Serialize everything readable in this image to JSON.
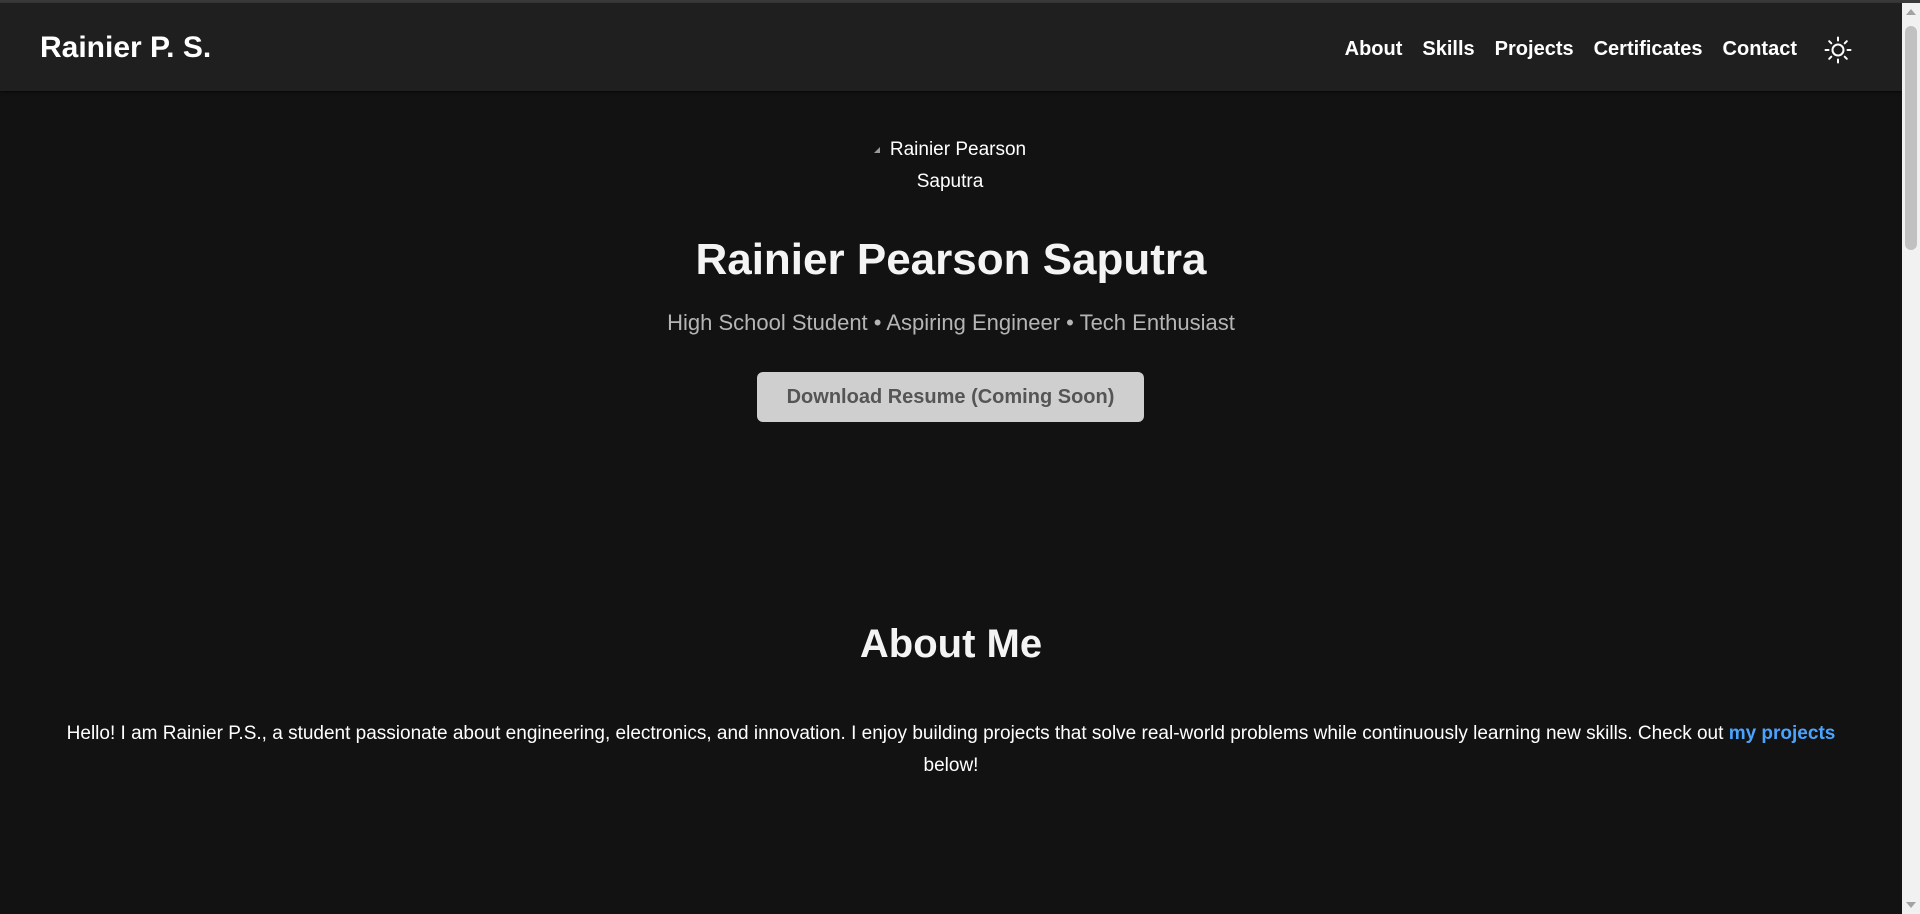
{
  "nav": {
    "brand": "Rainier P. S.",
    "links": [
      "About",
      "Skills",
      "Projects",
      "Certificates",
      "Contact"
    ]
  },
  "hero": {
    "image_alt_line1": "Rainier Pearson",
    "image_alt_line2": "Saputra",
    "name": "Rainier Pearson Saputra",
    "subtitle": "High School Student • Aspiring Engineer • Tech Enthusiast",
    "resume_button": "Download Resume (Coming Soon)"
  },
  "about": {
    "title": "About Me",
    "text_before": "Hello! I am Rainier P.S., a student passionate about engineering, electronics, and innovation. I enjoy building projects that solve real-world problems while continuously learning new skills. Check out ",
    "link_text": "my projects",
    "text_after": " below!"
  },
  "colors": {
    "background": "#121212",
    "navbar": "#1f1f1f",
    "link_accent": "#4aa3ff",
    "button_bg": "#cfcfcf"
  },
  "icons": {
    "theme_toggle": "sun-icon",
    "hero_image": "broken-image-icon"
  }
}
